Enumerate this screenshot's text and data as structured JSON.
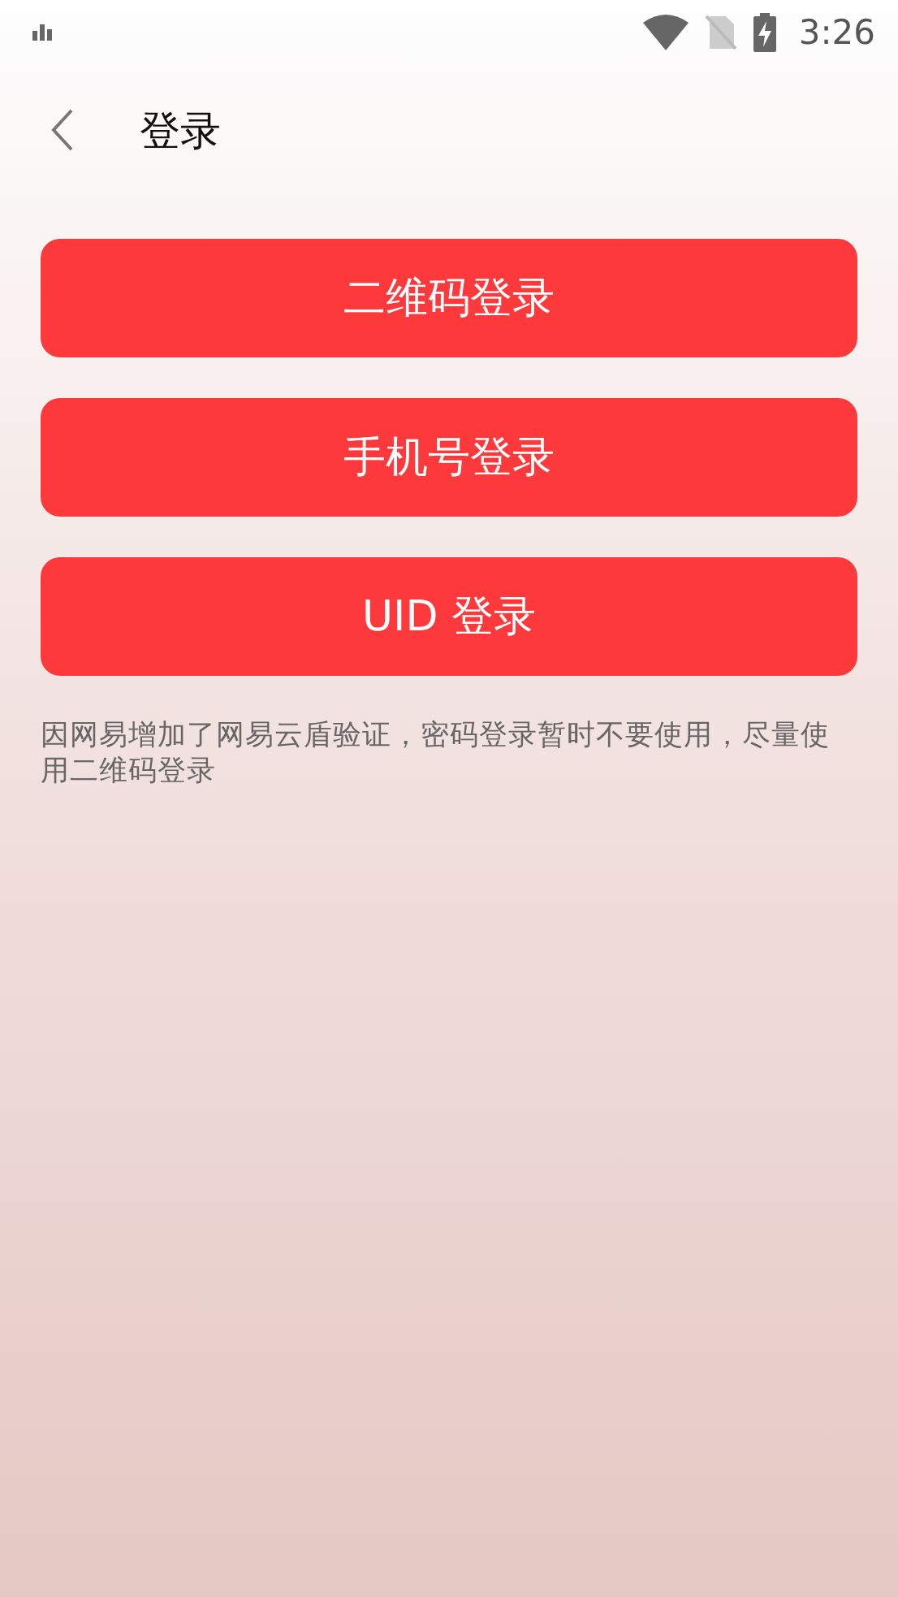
{
  "status_bar": {
    "time": "3:26"
  },
  "header": {
    "title": "登录"
  },
  "buttons": [
    {
      "label": "二维码登录"
    },
    {
      "label": "手机号登录"
    },
    {
      "label": "UID 登录"
    }
  ],
  "note": "因网易增加了网易云盾验证，密码登录暂时不要使用，尽量使用二维码登录"
}
